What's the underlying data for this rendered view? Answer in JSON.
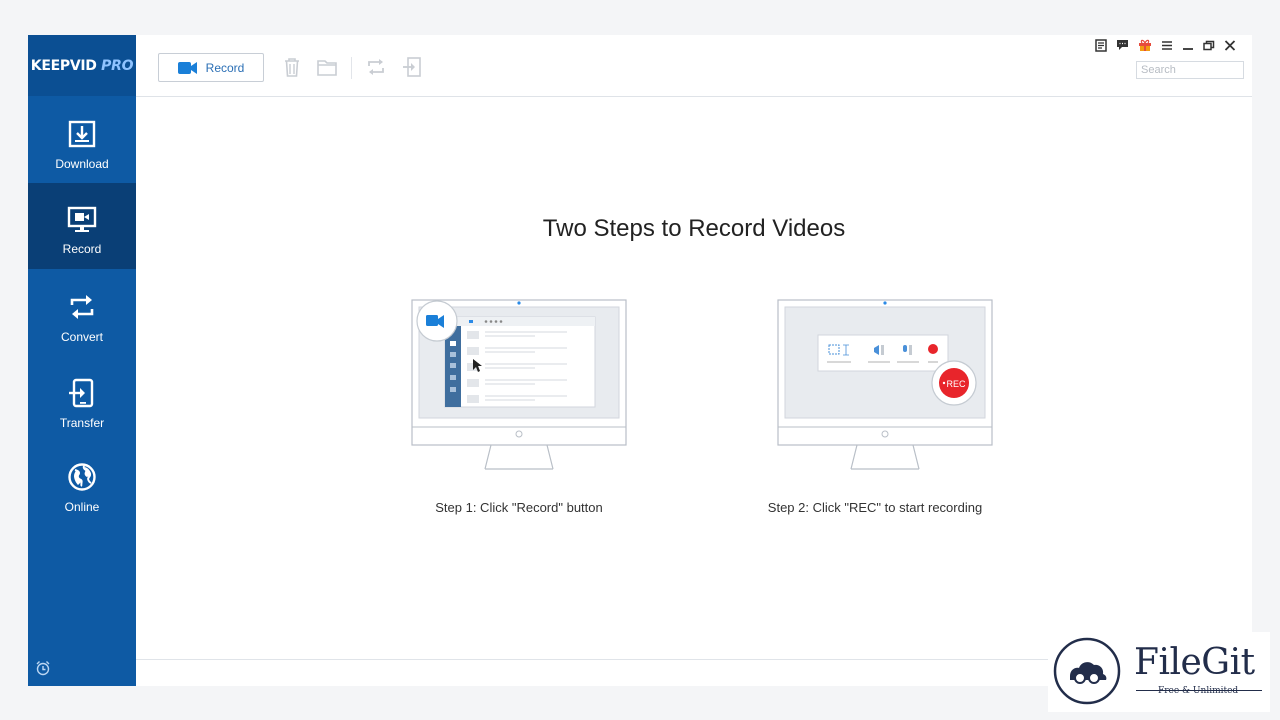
{
  "logo": {
    "brand": "KEEPVID",
    "edition": "PRO"
  },
  "sidebar": {
    "items": [
      {
        "label": "Download",
        "icon": "download-icon"
      },
      {
        "label": "Record",
        "icon": "monitor-record-icon",
        "active": true
      },
      {
        "label": "Convert",
        "icon": "convert-icon"
      },
      {
        "label": "Transfer",
        "icon": "transfer-icon"
      },
      {
        "label": "Online",
        "icon": "globe-icon"
      }
    ],
    "footer_icon": "alarm-clock-icon"
  },
  "toolbar": {
    "record_label": "Record",
    "icons": [
      "trash-icon",
      "folder-icon",
      "convert-icon",
      "import-icon"
    ]
  },
  "window_controls": [
    "notes-icon",
    "feedback-icon",
    "gift-icon",
    "menu-icon",
    "minimize-icon",
    "restore-icon",
    "close-icon"
  ],
  "search": {
    "placeholder": "Search",
    "value": ""
  },
  "main": {
    "headline": "Two Steps to Record Videos",
    "steps": [
      {
        "label": "Step 1: Click \"Record\" button"
      },
      {
        "label": "Step 2: Click \"REC\" to start recording",
        "badge": "REC"
      }
    ]
  },
  "watermark": {
    "title": "FileGit",
    "tagline": "Free & Unlimited"
  },
  "colors": {
    "sidebar": "#0e5aa4",
    "sidebar_active": "#0a3f76",
    "accent": "#2b8ae6",
    "rec_red": "#e8252b"
  }
}
